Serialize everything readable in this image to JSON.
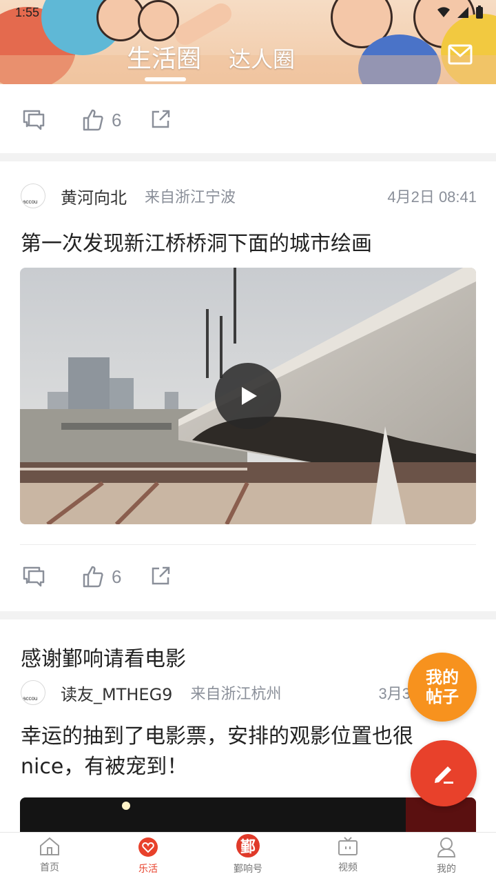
{
  "status": {
    "time": "1:55"
  },
  "header": {
    "tabs": [
      {
        "label": "生活圈",
        "active": true
      },
      {
        "label": "达人圈",
        "active": false
      }
    ],
    "mail_icon": "mail-icon"
  },
  "posts": [
    {
      "actions": {
        "likes": "6"
      }
    },
    {
      "author": "黄河向北",
      "location": "来自浙江宁波",
      "time": "4月2日 08:41",
      "title": "第一次发现新江桥桥洞下面的城市绘画",
      "media": "video",
      "avatar_text": "accou",
      "actions": {
        "likes": "6"
      }
    },
    {
      "title": "感谢鄞响请看电影",
      "author": "读友_MTHEG9",
      "location": "来自浙江杭州",
      "time": "3月3",
      "body": "幸运的抽到了电影票，安排的观影位置也很nice，有被宠到！",
      "avatar_text": "accou"
    }
  ],
  "fab": {
    "mine_line1": "我的",
    "mine_line2": "帖子"
  },
  "bottom_nav": [
    {
      "label": "首页",
      "icon": "home-icon",
      "active": false
    },
    {
      "label": "乐活",
      "icon": "heart-icon",
      "active": true
    },
    {
      "label": "鄞响号",
      "icon": "yinxiang-icon",
      "active": false,
      "icon_text": "鄞"
    },
    {
      "label": "视频",
      "icon": "tv-icon",
      "active": false
    },
    {
      "label": "我的",
      "icon": "profile-icon",
      "active": false
    }
  ],
  "colors": {
    "accent": "#e8412b",
    "orange": "#f7921e",
    "meta_gray": "#8a8f99"
  }
}
